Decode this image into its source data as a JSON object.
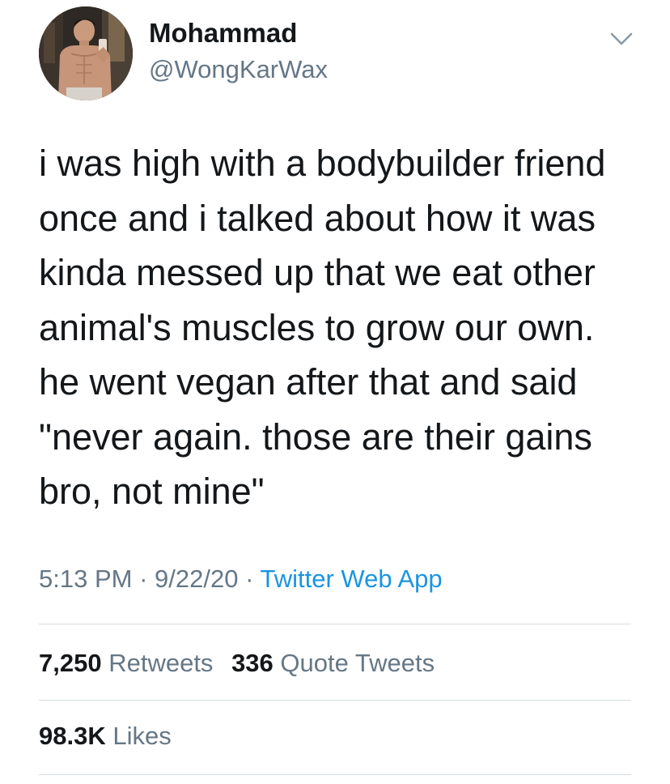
{
  "user": {
    "display_name": "Mohammad",
    "handle": "@WongKarWax",
    "avatar_icon": "profile-photo"
  },
  "tweet": {
    "lines": [
      "i was high with a bodybuilder friend",
      "once and i talked about how it was",
      "kinda messed up that we eat other",
      "animal's muscles to grow our own.",
      "he went vegan after that and said",
      "\"never again. those are their gains",
      "bro, not mine\""
    ],
    "time": "5:13 PM",
    "separator": "·",
    "date": "9/22/20",
    "source": "Twitter Web App"
  },
  "stats": {
    "retweets_count": "7,250",
    "retweets_label": "Retweets",
    "quotes_count": "336",
    "quotes_label": "Quote Tweets",
    "likes_count": "98.3K",
    "likes_label": "Likes"
  },
  "colors": {
    "text": "#14171a",
    "secondary": "#657786",
    "link": "#1b95e0",
    "divider": "#d6dde3"
  },
  "icons": {
    "menu": "chevron-down-icon"
  }
}
